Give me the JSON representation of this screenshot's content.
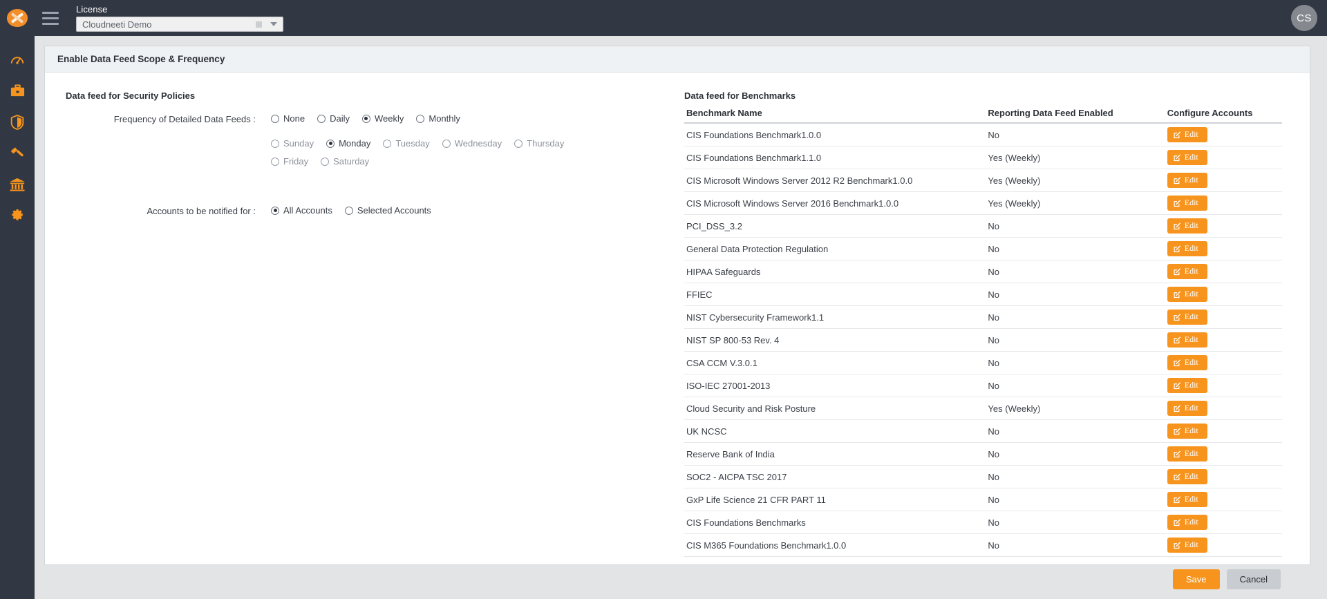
{
  "topbar": {
    "logo_name": "cloudneeti-logo",
    "menu_icon": "hamburger-menu-icon",
    "license_label": "License",
    "license_value": "Cloudneeti Demo",
    "avatar_initials": "CS"
  },
  "sidenav": {
    "items": [
      {
        "icon": "gauge-dashboard-icon",
        "name": "dashboard"
      },
      {
        "icon": "briefcase-icon",
        "name": "portfolio"
      },
      {
        "icon": "shield-icon",
        "name": "security"
      },
      {
        "icon": "gavel-icon",
        "name": "compliance"
      },
      {
        "icon": "bank-icon",
        "name": "governance"
      },
      {
        "icon": "gear-icon",
        "name": "settings"
      }
    ]
  },
  "card": {
    "title": "Enable Data Feed Scope & Frequency"
  },
  "security_policies": {
    "title": "Data feed for Security Policies",
    "frequency_label": "Frequency of Detailed Data Feeds :",
    "frequency_options": [
      {
        "label": "None",
        "checked": false
      },
      {
        "label": "Daily",
        "checked": false
      },
      {
        "label": "Weekly",
        "checked": true
      },
      {
        "label": "Monthly",
        "checked": false
      }
    ],
    "day_options": [
      {
        "label": "Sunday",
        "checked": false
      },
      {
        "label": "Monday",
        "checked": true
      },
      {
        "label": "Tuesday",
        "checked": false
      },
      {
        "label": "Wednesday",
        "checked": false
      },
      {
        "label": "Thursday",
        "checked": false
      },
      {
        "label": "Friday",
        "checked": false
      },
      {
        "label": "Saturday",
        "checked": false
      }
    ],
    "accounts_label": "Accounts to be notified for :",
    "accounts_options": [
      {
        "label": "All Accounts",
        "checked": true
      },
      {
        "label": "Selected Accounts",
        "checked": false
      }
    ]
  },
  "benchmarks": {
    "title": "Data feed for Benchmarks",
    "columns": [
      "Benchmark Name",
      "Reporting Data Feed Enabled",
      "Configure Accounts"
    ],
    "edit_label": "Edit",
    "edit_icon": "pencil-square-edit-icon",
    "rows": [
      {
        "name": "CIS Foundations Benchmark1.0.0",
        "enabled": "No"
      },
      {
        "name": "CIS Foundations Benchmark1.1.0",
        "enabled": "Yes (Weekly)"
      },
      {
        "name": "CIS Microsoft Windows Server 2012 R2 Benchmark1.0.0",
        "enabled": "Yes (Weekly)"
      },
      {
        "name": "CIS Microsoft Windows Server 2016 Benchmark1.0.0",
        "enabled": "Yes (Weekly)"
      },
      {
        "name": "PCI_DSS_3.2",
        "enabled": "No"
      },
      {
        "name": "General Data Protection Regulation",
        "enabled": "No"
      },
      {
        "name": "HIPAA Safeguards",
        "enabled": "No"
      },
      {
        "name": "FFIEC",
        "enabled": "No"
      },
      {
        "name": "NIST Cybersecurity Framework1.1",
        "enabled": "No"
      },
      {
        "name": "NIST SP 800-53 Rev. 4",
        "enabled": "No"
      },
      {
        "name": "CSA CCM V.3.0.1",
        "enabled": "No"
      },
      {
        "name": "ISO-IEC 27001-2013",
        "enabled": "No"
      },
      {
        "name": "Cloud Security and Risk Posture",
        "enabled": "Yes (Weekly)"
      },
      {
        "name": "UK NCSC",
        "enabled": "No"
      },
      {
        "name": "Reserve Bank of India",
        "enabled": "No"
      },
      {
        "name": "SOC2 - AICPA TSC 2017",
        "enabled": "No"
      },
      {
        "name": "GxP Life Science 21 CFR PART 11",
        "enabled": "No"
      },
      {
        "name": "CIS Foundations Benchmarks",
        "enabled": "No"
      },
      {
        "name": "CIS M365 Foundations Benchmark1.0.0",
        "enabled": "No"
      }
    ]
  },
  "actions": {
    "save_label": "Save",
    "cancel_label": "Cancel"
  },
  "colors": {
    "accent": "#f7941d",
    "topbar": "#323843",
    "page_bg": "#e2e4e6",
    "card_header": "#eff2f5"
  }
}
